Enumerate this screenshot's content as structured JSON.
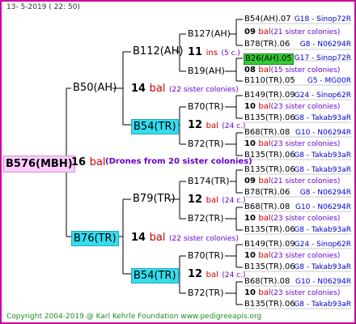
{
  "header": {
    "date": "13-  5-2019 (  22:  50)"
  },
  "footer": {
    "copyright": "Copyright 2004-2019 @ Karl Kehrle Foundation     www.pedigreeapis.org"
  },
  "root": {
    "name": "B576(MBH)",
    "count": "16",
    "bal": "bal",
    "drones": "(Drones from 20 sister colonies)"
  },
  "gen1": [
    {
      "name": "B50(AH)",
      "count": "14",
      "bal": "bal",
      "sis": "(22 sister colonies)"
    },
    {
      "name": "B76(TR)",
      "count": "14",
      "bal": "bal",
      "sis": "(22 sister colonies)"
    }
  ],
  "gen2": [
    {
      "name": "B112(AH)",
      "count": "11",
      "ins": "ins",
      "sis": "(5 c.)"
    },
    {
      "name": "B54(TR)",
      "count": "12",
      "bal": "bal",
      "sis": "(24 c.)"
    },
    {
      "name": "B79(TR)",
      "count": "12",
      "bal": "bal",
      "sis": "(24 c.)"
    },
    {
      "name": "B54(TR)",
      "count": "12",
      "bal": "bal",
      "sis": "(24 c.)"
    }
  ],
  "gen3": [
    "B127(AH)",
    "B19(AH)",
    "B70(TR)",
    "B72(TR)",
    "B174(TR)",
    "B72(TR)",
    "B70(TR)",
    "B72(TR)"
  ],
  "leaves": [
    {
      "name": "B54(AH).07",
      "ref": "G18 - Sinop72R"
    },
    {
      "count": "09",
      "bal": "bal",
      "sis": "(21 sister colonies)"
    },
    {
      "name": "B78(TR).06",
      "ref": "G8 - N06294R"
    },
    {
      "name": "B26(AH).05",
      "ref": "G17 - Sinop72R"
    },
    {
      "count": "08",
      "bal": "bal",
      "sis": "(15 sister colonies)"
    },
    {
      "name": "B110(TR).05",
      "ref": "G5 - MG00R"
    },
    {
      "name": "B149(TR).09",
      "ref": "G24 - Sinop62R"
    },
    {
      "count": "10",
      "bal": "bal",
      "sis": "(23 sister colonies)"
    },
    {
      "name": "B135(TR).06",
      "ref": "G8 - Takab93aR"
    },
    {
      "name": "B68(TR).08",
      "ref": "G10 - N06294R"
    },
    {
      "count": "10",
      "bal": "bal",
      "sis": "(23 sister colonies)"
    },
    {
      "name": "B135(TR).06",
      "ref": "G8 - Takab93aR"
    },
    {
      "name": "B135(TR).06",
      "ref": "G8 - Takab93aR"
    },
    {
      "count": "09",
      "bal": "bal",
      "sis": "(21 sister colonies)"
    },
    {
      "name": "B78(TR).06",
      "ref": "G8 - N06294R"
    },
    {
      "name": "B68(TR).08",
      "ref": "G10 - N06294R"
    },
    {
      "count": "10",
      "bal": "bal",
      "sis": "(23 sister colonies)"
    },
    {
      "name": "B135(TR).06",
      "ref": "G8 - Takab93aR"
    },
    {
      "name": "B149(TR).09",
      "ref": "G24 - Sinop62R"
    },
    {
      "count": "10",
      "bal": "bal",
      "sis": "(23 sister colonies)"
    },
    {
      "name": "B135(TR).06",
      "ref": "G8 - Takab93aR"
    },
    {
      "name": "B68(TR).08",
      "ref": "G10 - N06294R"
    },
    {
      "count": "10",
      "bal": "bal",
      "sis": "(23 sister colonies)"
    },
    {
      "name": "B135(TR).06",
      "ref": "G8 - Takab93aR"
    }
  ],
  "colors": {
    "frame": "#cc0099",
    "root_bg": "#ffccff",
    "highlight_cyan": "#33ddee",
    "highlight_green": "#33cc33",
    "bal": "#cc0000",
    "sister": "#6600cc",
    "ref": "#0000cc",
    "footer": "#228b22"
  }
}
